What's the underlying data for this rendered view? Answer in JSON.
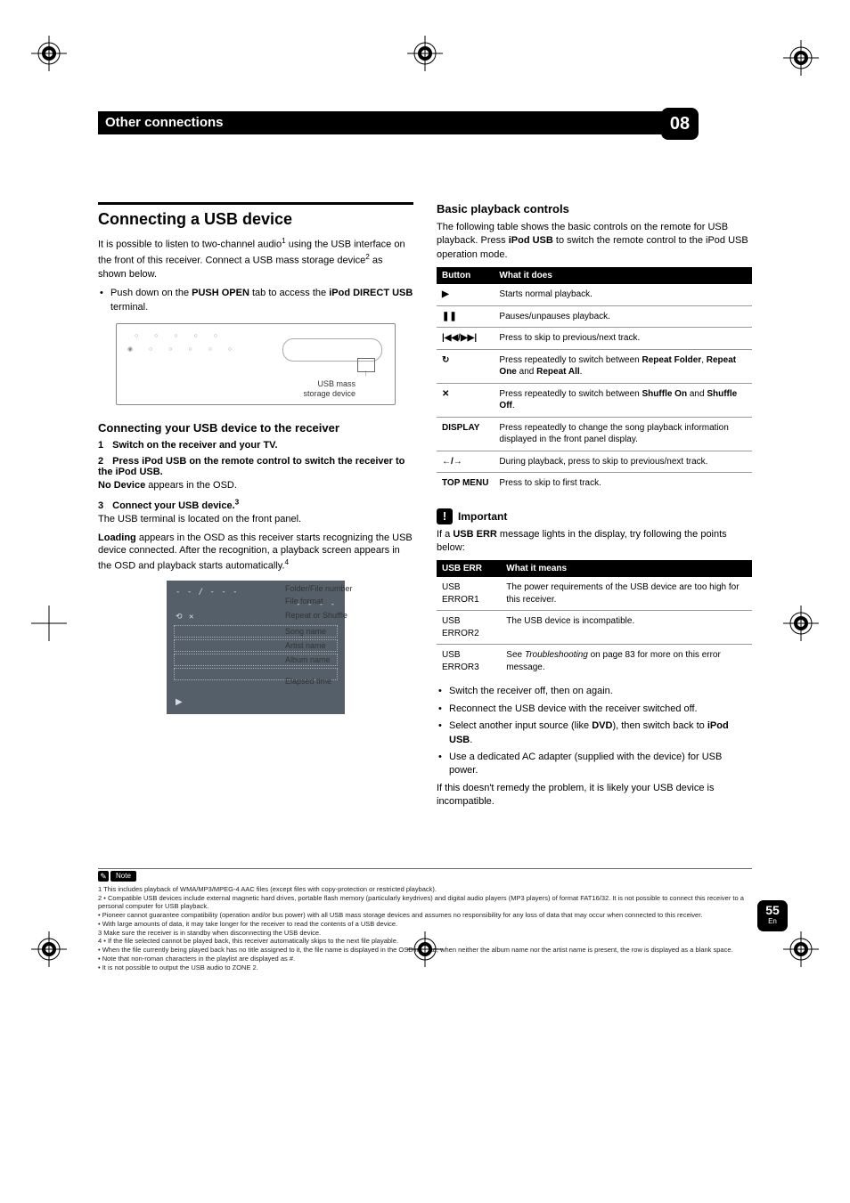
{
  "header": {
    "title": "Other connections",
    "chapter": "08"
  },
  "left": {
    "section_title": "Connecting a USB device",
    "intro_a": "It is possible to listen to two-channel audio",
    "intro_sup1": "1",
    "intro_b": " using the USB interface on the front of this receiver. Connect a USB mass storage device",
    "intro_sup2": "2",
    "intro_c": " as shown below.",
    "bullet1_a": "Push down on the ",
    "bullet1_b": "PUSH OPEN",
    "bullet1_c": " tab to access the ",
    "bullet1_d": "iPod DIRECT USB",
    "bullet1_e": " terminal.",
    "diagram_label1": "USB mass",
    "diagram_label2": "storage device",
    "sub1_title": "Connecting your USB device to the receiver",
    "step1_num": "1",
    "step1_txt": "Switch on the receiver and your TV.",
    "step2_num": "2",
    "step2_txt": "Press iPod USB on the remote control to switch the receiver to the iPod USB.",
    "step2_sub_a": "No Device",
    "step2_sub_b": " appears in the OSD.",
    "step3_num": "3",
    "step3_txt_a": "Connect your USB device.",
    "step3_sup": "3",
    "step3_p1": "The USB terminal is located on the front panel.",
    "step3_p2_a": "Loading",
    "step3_p2_b": " appears in the OSD as this receiver starts recognizing the USB device connected. After the recognition, a playback screen appears in the OSD and playback starts automatically.",
    "step3_p2_sup": "4",
    "osd": {
      "labels": [
        "Folder/File number",
        "File format",
        "Repeat or Shuffle",
        "Song name",
        "Artist name",
        "Album name",
        "Elapsed time"
      ],
      "row1": "- - / - - -",
      "row2": "- - - -",
      "play": "▶"
    }
  },
  "right": {
    "sub_title": "Basic playback controls",
    "intro_a": "The following table shows the basic controls on the remote for USB playback. Press ",
    "intro_b": "iPod USB",
    "intro_c": " to switch the remote control to the iPod USB operation mode.",
    "table1": {
      "headers": [
        "Button",
        "What it does"
      ],
      "rows": [
        {
          "btn": "▶",
          "desc": "Starts normal playback."
        },
        {
          "btn": "❚❚",
          "desc": "Pauses/unpauses playback."
        },
        {
          "btn": "|◀◀/▶▶|",
          "desc": "Press to skip to previous/next track."
        },
        {
          "btn": "↻",
          "desc_a": "Press repeatedly to switch between ",
          "b1": "Repeat Folder",
          "comma": ", ",
          "b2": "Repeat One",
          "and": " and ",
          "b3": "Repeat All",
          "dot": "."
        },
        {
          "btn": "✕",
          "desc_a": "Press repeatedly to switch between ",
          "b1": "Shuffle On",
          "and": " and ",
          "b2": "Shuffle Off",
          "dot": "."
        },
        {
          "btn": "DISPLAY",
          "desc": "Press repeatedly to change the song playback information displayed in the front panel display."
        },
        {
          "btn": "←/→",
          "desc": "During playback, press to skip to previous/next track."
        },
        {
          "btn": "TOP MENU",
          "desc": "Press to skip to first track."
        }
      ]
    },
    "important_label": "Important",
    "important_p_a": "If a ",
    "important_p_b": "USB ERR",
    "important_p_c": " message lights in the display, try following the points below:",
    "table2": {
      "headers": [
        "USB ERR",
        "What it means"
      ],
      "rows": [
        {
          "k": "USB ERROR1",
          "v": "The power requirements of the USB device are too high for this receiver."
        },
        {
          "k": "USB ERROR2",
          "v": "The USB device is incompatible."
        },
        {
          "k": "USB ERROR3",
          "v_a": "See ",
          "v_i": "Troubleshooting",
          "v_b": " on page 83 for more on this error message."
        }
      ]
    },
    "bullets": [
      "Switch the receiver off, then on again.",
      "Reconnect the USB device with the receiver switched off."
    ],
    "bullet3_a": "Select another input source (like ",
    "bullet3_b": "DVD",
    "bullet3_c": "), then switch back to ",
    "bullet3_d": "iPod USB",
    "bullet3_e": ".",
    "bullet4": "Use a dedicated AC adapter (supplied with the device) for USB power.",
    "closing": "If this doesn't remedy the problem, it is likely your USB device is incompatible."
  },
  "notes": {
    "label": "Note",
    "lines": [
      "1 This includes playback of WMA/MP3/MPEG-4 AAC files (except files with copy-protection or restricted playback).",
      "2 • Compatible USB devices include external magnetic hard drives, portable flash memory (particularly keydrives) and digital audio players (MP3 players) of format FAT16/32. It is not possible to connect this receiver to a personal computer for USB playback.",
      "   • Pioneer cannot guarantee compatibility (operation and/or bus power) with all USB mass storage devices and assumes no responsibility for any loss of data that may occur when connected to this receiver.",
      "   • With large amounts of data, it may take longer for the receiver to read the contents of a USB device.",
      "3 Make sure the receiver is in standby when disconnecting the USB device.",
      "4 • If the file selected cannot be played back, this receiver automatically skips to the next file playable.",
      "   • When the file currently being played back has no title assigned to it, the file name is displayed in the OSD instead; when neither the album name nor the artist name is present, the row is displayed as a blank space.",
      "   • Note that non-roman characters in the playlist are displayed as #.",
      "   • It is not possible to output the USB audio to ZONE 2."
    ]
  },
  "page_number": "55",
  "page_lang": "En"
}
